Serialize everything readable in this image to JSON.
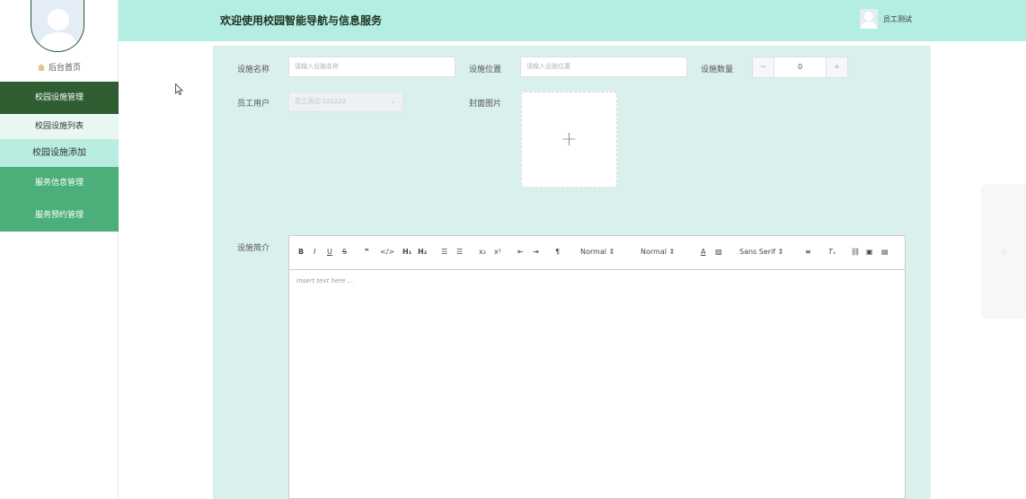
{
  "sidebar": {
    "home_label": "后台首页",
    "items": [
      {
        "label": "校园设施管理"
      },
      {
        "label": "校园设施列表"
      },
      {
        "label": "校园设施添加"
      },
      {
        "label": "服务信息管理"
      },
      {
        "label": "服务预约管理"
      }
    ]
  },
  "header": {
    "title": "欢迎使用校园智能导航与信息服务",
    "user_name": "员工测试"
  },
  "form": {
    "name_label": "设施名称",
    "name_placeholder": "请输入设施名称",
    "location_label": "设施位置",
    "location_placeholder": "请输入设施位置",
    "quantity_label": "设施数量",
    "quantity_value": "0",
    "minus": "−",
    "plus": "+",
    "staff_label": "员工用户",
    "staff_value": "员工测试-222222",
    "cover_label": "封面图片",
    "uploader_plus": "+",
    "intro_label": "设施简介"
  },
  "editor": {
    "placeholder": "Insert text here ...",
    "header_select": "Normal",
    "size_select": "Normal",
    "font_select": "Sans Serif"
  },
  "colors": {
    "header_bg": "#b4ede2",
    "menu_dark": "#2f5e32",
    "menu_green": "#4caf7a",
    "panel_bg": "#daf0ec"
  }
}
